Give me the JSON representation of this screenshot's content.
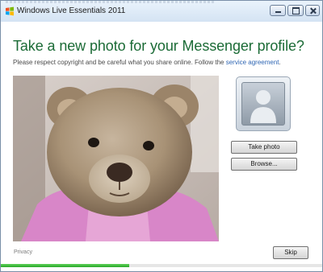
{
  "window": {
    "title": "Windows Live Essentials 2011"
  },
  "page": {
    "heading": "Take a new photo for your Messenger profile?",
    "subtext_prefix": "Please respect copyright and be careful what you share online. Follow the ",
    "subtext_link": "service agreement",
    "subtext_suffix": "."
  },
  "actions": {
    "take_photo_label": "Take photo",
    "browse_label": "Browse..."
  },
  "footer": {
    "privacy_label": "Privacy",
    "skip_label": "Skip"
  },
  "progress": {
    "fraction": 0.4
  },
  "icons": {
    "app": "windows-flag-icon",
    "avatar": "user-silhouette-icon",
    "preview": "webcam-preview-teddy-bear"
  },
  "colors": {
    "heading_green": "#1b6b36",
    "link_blue": "#2f66b3",
    "progress_green": "#2aa82a"
  }
}
